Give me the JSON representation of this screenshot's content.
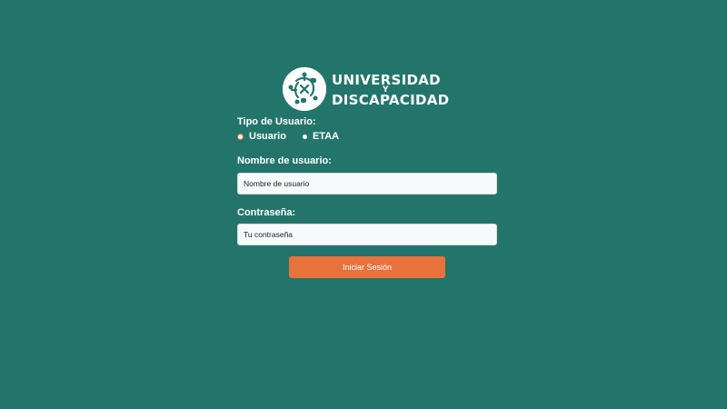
{
  "logo": {
    "line1": "UNIVERSIDAD",
    "connector": "Y",
    "line2": "DISCAPACIDAD"
  },
  "user_type": {
    "label": "Tipo de Usuario:",
    "options": [
      {
        "label": "Usuario",
        "selected": true
      },
      {
        "label": "ETAA",
        "selected": false
      }
    ]
  },
  "username": {
    "label": "Nombre de usuario:",
    "placeholder": "Nombre de usuario",
    "value": ""
  },
  "password": {
    "label": "Contraseña:",
    "placeholder": "Tu contraseña",
    "value": ""
  },
  "submit": {
    "label": "Iniciar Sesión"
  },
  "colors": {
    "background": "#23756b",
    "accent": "#e9713c",
    "input_bg": "#f8f9fc",
    "text": "#ffffff"
  },
  "icons": {
    "logo": "puzzle-people-icon"
  }
}
